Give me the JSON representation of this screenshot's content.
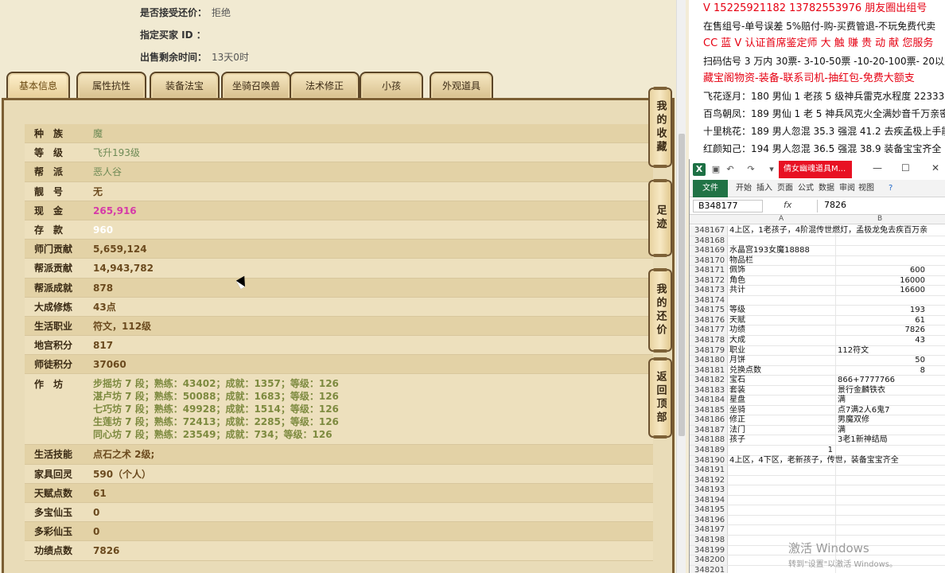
{
  "top_info": [
    {
      "label": "是否接受还价：",
      "value": "拒绝"
    },
    {
      "label": "指定买家 ID ：",
      "value": ""
    },
    {
      "label": "出售剩余时间：",
      "value": "13天0时"
    }
  ],
  "tabs": [
    "基本信息",
    "属性抗性",
    "装备法宝",
    "坐骑召唤兽",
    "法术修正",
    "小孩",
    "外观道具"
  ],
  "side_buttons": [
    "我的收藏",
    "足迹",
    "我的还价",
    "返回顶部"
  ],
  "rows": [
    {
      "k": "种　族",
      "v": "魔",
      "style": "green"
    },
    {
      "k": "等　级",
      "v": "飞升193级",
      "style": "green"
    },
    {
      "k": "帮　派",
      "v": "恶人谷",
      "style": "green"
    },
    {
      "k": "靓　号",
      "v": "无",
      "style": "dark"
    },
    {
      "k": "现　金",
      "v": "265,916",
      "style": "pink"
    },
    {
      "k": "存　款",
      "v": "960",
      "style": "white"
    },
    {
      "k": "师门贡献",
      "v": "5,659,124",
      "style": "dark"
    },
    {
      "k": "帮派贡献",
      "v": "14,943,782",
      "style": "dark"
    },
    {
      "k": "帮派成就",
      "v": "878",
      "style": "dark"
    },
    {
      "k": "大成修炼",
      "v": "43点",
      "style": "dark"
    },
    {
      "k": "生活职业",
      "v": "符文，112级",
      "style": "dark"
    },
    {
      "k": "地宫积分",
      "v": "817",
      "style": "dark"
    },
    {
      "k": "师徒积分",
      "v": "37060",
      "style": "dark"
    }
  ],
  "workshop": {
    "label": "作　坊",
    "lines": [
      "步摇坊 7 段；熟练：43402；成就：1357；等级：126",
      "湛卢坊 7 段；熟练：50088；成就：1683；等级：126",
      "七巧坊 7 段；熟练：49928；成就：1514；等级：126",
      "生莲坊 7 段；熟练：72413；成就：2285；等级：126",
      "同心坊 7 段；熟练：23549；成就：734；等级：126"
    ]
  },
  "rows2": [
    {
      "k": "生活技能",
      "v": "点石之术 2级;",
      "style": "dark"
    },
    {
      "k": "家具回灵",
      "v": "590（个人）",
      "style": "dark"
    },
    {
      "k": "天赋点数",
      "v": "61",
      "style": "dark"
    },
    {
      "k": "多宝仙玉",
      "v": "0",
      "style": "dark"
    },
    {
      "k": "多彩仙玉",
      "v": "0",
      "style": "dark"
    },
    {
      "k": "功绩点数",
      "v": "7826",
      "style": "dark"
    }
  ],
  "ad_lines": [
    {
      "text": "V 15225921182   13782553976 朋友圈出组号",
      "color": "red"
    },
    {
      "text": "在售组号-单号误差 5%赔付-购-买费管退-不玩免费代卖",
      "color": "black"
    },
    {
      "text": "CC 蓝 V 认证首席鉴定师 大 触 赚 贵 动 献 您服务",
      "color": "red"
    },
    {
      "text": "扫码估号 3 万内 30票- 3-10-50票 -10-20-100票- 20以上 150",
      "color": "black"
    },
    {
      "text": "藏宝阁物资-装备-联系司机-抽红包-免费大额支",
      "color": "red"
    },
    {
      "text": "飞花逐月：180 男仙 1 老孩 5 级神兵雷克水程度 22333",
      "color": "black"
    },
    {
      "text": "百鸟朝凤：189 男仙 1 老 5 神兵风克火全满妙音千万亲密 21",
      "color": "black"
    },
    {
      "text": "十里桃花：189 男人忽混 35.3 强混 41.2 去疾孟极上手能玩 2",
      "color": "black"
    },
    {
      "text": "红颜知己：194 男人忽混 36.5 强混 38.9 装备宝宝齐全 27500",
      "color": "black"
    }
  ],
  "excel": {
    "title": "倩女幽魂道具M...",
    "ribbon_tabs": [
      "文件",
      "开始",
      "插入",
      "页面",
      "公式",
      "数据",
      "审阅",
      "视图"
    ],
    "namebox": "B348177",
    "formula_value": "7826",
    "col_a": "A",
    "col_b": "B",
    "rows": [
      {
        "n": "348167",
        "a": "4上区，1老孩子，4阶混传世燃灯，孟极龙兔去疾百万亲",
        "b": ""
      },
      {
        "n": "348168",
        "a": "",
        "b": ""
      },
      {
        "n": "348169",
        "a": "水晶宫193女魔18888",
        "b": ""
      },
      {
        "n": "348170",
        "a": "物品栏",
        "b": ""
      },
      {
        "n": "348171",
        "a": "佩饰",
        "b": "600"
      },
      {
        "n": "348172",
        "a": "角色",
        "b": "16000"
      },
      {
        "n": "348173",
        "a": "共计",
        "b": "16600"
      },
      {
        "n": "348174",
        "a": "",
        "b": ""
      },
      {
        "n": "348175",
        "a": "等级",
        "b": "193"
      },
      {
        "n": "348176",
        "a": "天赋",
        "b": "61"
      },
      {
        "n": "348177",
        "a": "功绩",
        "b": "7826"
      },
      {
        "n": "348178",
        "a": "大成",
        "b": "43"
      },
      {
        "n": "348179",
        "a": "职业",
        "b": "112符文",
        "left": true
      },
      {
        "n": "348180",
        "a": "月饼",
        "b": "50"
      },
      {
        "n": "348181",
        "a": "兑换点数",
        "b": "8"
      },
      {
        "n": "348182",
        "a": "宝石",
        "b": "866+7777766",
        "left": true
      },
      {
        "n": "348183",
        "a": "套装",
        "b": "景行金麟铁衣",
        "left": true
      },
      {
        "n": "348184",
        "a": "星盘",
        "b": "满",
        "left": true
      },
      {
        "n": "348185",
        "a": "坐骑",
        "b": "点7满2人6鬼7",
        "left": true
      },
      {
        "n": "348186",
        "a": "修正",
        "b": "男魔双修",
        "left": true
      },
      {
        "n": "348187",
        "a": "法门",
        "b": "满",
        "left": true
      },
      {
        "n": "348188",
        "a": "孩子",
        "b": "3老1新神结局",
        "left": true
      },
      {
        "n": "348189",
        "a": "1",
        "b": ""
      },
      {
        "n": "348190",
        "a": "4上区，4下区，老新孩子，传世，装备宝宝齐全",
        "b": ""
      },
      {
        "n": "348191",
        "a": "",
        "b": ""
      },
      {
        "n": "348192",
        "a": "",
        "b": ""
      },
      {
        "n": "348193",
        "a": "",
        "b": ""
      },
      {
        "n": "348194",
        "a": "",
        "b": ""
      },
      {
        "n": "348195",
        "a": "",
        "b": ""
      },
      {
        "n": "348196",
        "a": "",
        "b": ""
      },
      {
        "n": "348197",
        "a": "",
        "b": ""
      },
      {
        "n": "348198",
        "a": "",
        "b": ""
      },
      {
        "n": "348199",
        "a": "",
        "b": ""
      },
      {
        "n": "348200",
        "a": "",
        "b": ""
      },
      {
        "n": "348201",
        "a": "",
        "b": ""
      }
    ],
    "watermark": "激活 Windows",
    "watermark_sub": "转到\"设置\"以激活 Windows。"
  }
}
